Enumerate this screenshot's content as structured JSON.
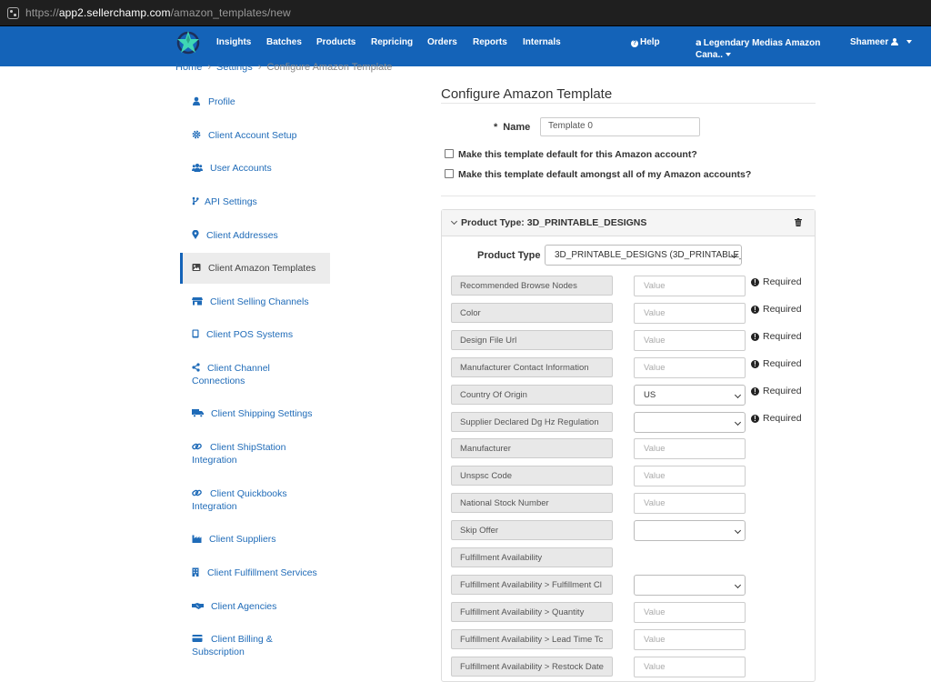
{
  "browser": {
    "url_scheme": "https://",
    "url_host": "app2.sellerchamp.com",
    "url_path": "/amazon_templates/new"
  },
  "topnav": {
    "items": [
      "Insights",
      "Batches",
      "Products",
      "Repricing",
      "Orders",
      "Reports",
      "Internals"
    ],
    "help": "Help",
    "account_line1": "Legendary Medias Amazon",
    "account_line2": "Cana..",
    "user": "Shameer"
  },
  "breadcrumb": {
    "home": "Home",
    "settings": "Settings",
    "current": "Configure Amazon Template"
  },
  "sidebar": {
    "items": [
      {
        "label": "Profile",
        "icon": "user-icon"
      },
      {
        "label": "Client Account Setup",
        "icon": "gear-icon"
      },
      {
        "label": "User Accounts",
        "icon": "users-icon"
      },
      {
        "label": "API Settings",
        "icon": "code-branch-icon"
      },
      {
        "label": "Client Addresses",
        "icon": "map-marker-icon"
      },
      {
        "label": "Client Amazon Templates",
        "icon": "image-icon"
      },
      {
        "label": "Client Selling Channels",
        "icon": "store-icon"
      },
      {
        "label": "Client POS Systems",
        "icon": "tablet-icon"
      },
      {
        "label": "Client Channel",
        "label2": "Connections",
        "icon": "share-icon"
      },
      {
        "label": "Client Shipping Settings",
        "icon": "truck-icon"
      },
      {
        "label": "Client ShipStation",
        "label2": "Integration",
        "icon": "link-icon"
      },
      {
        "label": "Client Quickbooks",
        "label2": "Integration",
        "icon": "link-icon"
      },
      {
        "label": "Client Suppliers",
        "icon": "industry-icon"
      },
      {
        "label": "Client Fulfillment Services",
        "icon": "building-icon"
      },
      {
        "label": "Client Agencies",
        "icon": "handshake-icon"
      },
      {
        "label": "Client Billing &",
        "label2": "Subscription",
        "icon": "credit-card-icon"
      }
    ]
  },
  "main": {
    "title": "Configure Amazon Template",
    "name_label": "Name",
    "name_required_mark": "*",
    "name_value": "Template 0",
    "checkbox_default_account": "Make this template default for this Amazon account?",
    "checkbox_default_all": "Make this template default amongst all of my Amazon accounts?",
    "panel_title": "Product Type: 3D_PRINTABLE_DESIGNS",
    "product_type_label": "Product Type",
    "product_type_value": "3D_PRINTABLE_DESIGNS (3D_PRINTABLE_D",
    "required_text": "Required",
    "attributes": [
      {
        "label": "Recommended Browse Nodes",
        "control": "input",
        "value": "Value",
        "required": true
      },
      {
        "label": "Color",
        "control": "input",
        "value": "Value",
        "required": true
      },
      {
        "label": "Design File Url",
        "control": "input",
        "value": "Value",
        "required": true
      },
      {
        "label": "Manufacturer Contact Information",
        "control": "input",
        "value": "Value",
        "required": true
      },
      {
        "label": "Country Of Origin",
        "control": "select",
        "value": "US",
        "required": true
      },
      {
        "label": "Supplier Declared Dg Hz Regulation",
        "control": "select",
        "value": "",
        "required": true
      },
      {
        "label": "Manufacturer",
        "control": "input",
        "value": "Value",
        "required": false
      },
      {
        "label": "Unspsc Code",
        "control": "input",
        "value": "Value",
        "required": false
      },
      {
        "label": "National Stock Number",
        "control": "input",
        "value": "Value",
        "required": false
      },
      {
        "label": "Skip Offer",
        "control": "select",
        "value": "",
        "required": false
      },
      {
        "label": "Fulfillment Availability",
        "control": "none",
        "value": "",
        "required": false
      },
      {
        "label": "Fulfillment Availability > Fulfillment Cl",
        "control": "select",
        "value": "",
        "required": false
      },
      {
        "label": "Fulfillment Availability > Quantity",
        "control": "input",
        "value": "Value",
        "required": false
      },
      {
        "label": "Fulfillment Availability > Lead Time Tc",
        "control": "input",
        "value": "Value",
        "required": false
      },
      {
        "label": "Fulfillment Availability > Restock Date",
        "control": "input",
        "value": "Value",
        "required": false
      }
    ]
  },
  "colors": {
    "nav_bg": "#1463b8",
    "link": "#1f6bb8",
    "label_bg": "#e8e8e8"
  }
}
